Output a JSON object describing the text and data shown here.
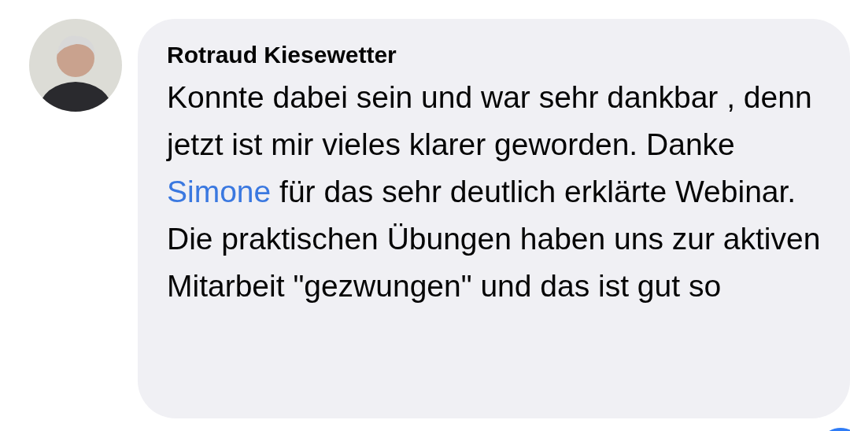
{
  "comment": {
    "author": "Rotraud Kiesewetter",
    "parts": [
      {
        "kind": "plain",
        "text": "Konnte dabei sein und war sehr dankbar , denn jetzt ist mir vieles klarer geworden. Danke "
      },
      {
        "kind": "mention",
        "text": "Simone"
      },
      {
        "kind": "plain",
        "text": " für das sehr deutlich erklärte Webinar. Die praktischen Übungen haben uns zur aktiven Mitarbeit \"gezwungen\" und das ist gut so"
      }
    ]
  }
}
